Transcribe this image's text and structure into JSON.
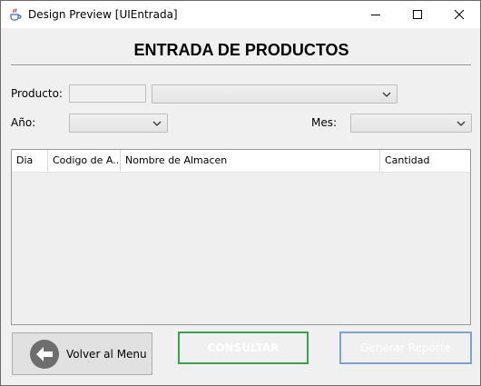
{
  "window": {
    "title": "Design Preview [UIEntrada]"
  },
  "page": {
    "heading": "ENTRADA DE PRODUCTOS"
  },
  "form": {
    "producto_label": "Producto:",
    "anio_label": "Año:",
    "mes_label": "Mes:",
    "producto_code_value": "",
    "producto_selected": "",
    "anio_selected": "",
    "mes_selected": ""
  },
  "table": {
    "columns": [
      "Dia",
      "Codigo de A...",
      "Nombre de Almacen",
      "Cantidad"
    ],
    "rows": []
  },
  "buttons": {
    "volver": "Volver al Menu",
    "consultar": "CONSULTAR",
    "reporte": "Generar Reporte"
  },
  "colors": {
    "consultar_border": "#37a24a",
    "reporte_border": "#7ea2c9",
    "back_icon_circle": "#6e6e6e"
  },
  "icons": {
    "app": "java-coffee-cup-icon",
    "minimize": "minimize-icon",
    "maximize": "maximize-icon",
    "close": "close-icon",
    "back": "arrow-left-circle-icon",
    "dropdown": "chevron-down-icon"
  }
}
